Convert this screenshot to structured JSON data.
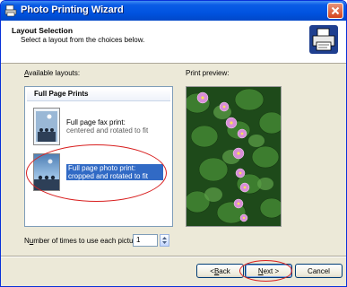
{
  "window": {
    "title": "Photo Printing Wizard"
  },
  "header": {
    "title": "Layout Selection",
    "subtitle": "Select a layout from the choices below."
  },
  "layouts": {
    "label": "Available layouts:",
    "label_mnemonic": "A",
    "label_rest": "vailable layouts:",
    "group": "Full Page Prints",
    "items": [
      {
        "title": "Full page fax print:",
        "sub": "centered and rotated to fit",
        "selected": false
      },
      {
        "title": "Full page photo print:",
        "sub": "cropped and rotated to fit",
        "selected": true
      }
    ]
  },
  "preview": {
    "label": "Print preview:"
  },
  "copies": {
    "label_pre": "N",
    "label_mnemonic": "u",
    "label_post": "mber of times to use each picture:",
    "value": "1"
  },
  "buttons": {
    "back_pre": "< ",
    "back_mnemonic": "B",
    "back_post": "ack",
    "next_mnemonic": "N",
    "next_post": "ext >",
    "cancel": "Cancel"
  },
  "colors": {
    "title_bar": "#0053e0",
    "selection": "#316ac5",
    "annotation": "#d81f1f"
  }
}
